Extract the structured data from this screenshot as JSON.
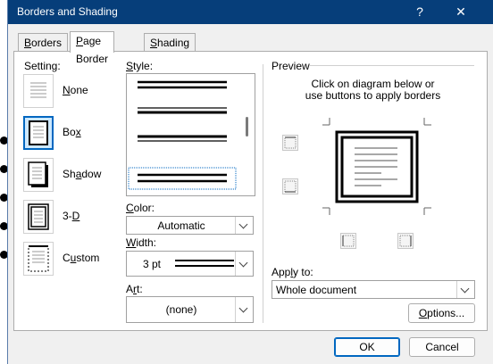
{
  "window": {
    "title": "Borders and Shading",
    "help": "?",
    "close": "✕"
  },
  "tabs": [
    {
      "label_u": "B",
      "label_rest": "orders"
    },
    {
      "label_pre": "",
      "label_u": "P",
      "label_rest": "age Border"
    },
    {
      "label_u": "S",
      "label_rest": "hading"
    }
  ],
  "setting": {
    "heading": "Setting:",
    "items": [
      {
        "label_u": "N",
        "label_rest": "one",
        "selected": false
      },
      {
        "label_u": "x",
        "label_pre": "Bo",
        "label_rest": "",
        "selected": true
      },
      {
        "label_pre": "Sh",
        "label_u": "a",
        "label_rest": "dow",
        "selected": false
      },
      {
        "label_pre": "3-",
        "label_u": "D",
        "label_rest": "",
        "selected": false
      },
      {
        "label_pre": "C",
        "label_u": "u",
        "label_rest": "stom",
        "selected": false
      }
    ]
  },
  "style": {
    "heading_u": "S",
    "heading_pre": "",
    "heading_rest": "tyle:",
    "lines": [
      "double-thick",
      "thin-thick",
      "thick-thin",
      "double-thick-selected"
    ],
    "selected_index": 3
  },
  "color": {
    "label_pre": "",
    "label_u": "C",
    "label_rest": "olor:",
    "value": "Automatic"
  },
  "width": {
    "label_u": "W",
    "label_rest": "idth:",
    "value": "3 pt"
  },
  "art": {
    "label_pre": "A",
    "label_u": "r",
    "label_rest": "t:",
    "value": "(none)"
  },
  "preview": {
    "heading": "Preview",
    "instruction_line1": "Click on diagram below or",
    "instruction_line2": "use buttons to apply borders"
  },
  "apply_to": {
    "label_pre": "App",
    "label_u": "l",
    "label_rest": "y to:",
    "value": "Whole document"
  },
  "buttons": {
    "options_u": "O",
    "options_rest": "ptions...",
    "ok": "OK",
    "cancel": "Cancel"
  },
  "colors": {
    "titlebar": "#063e7a",
    "accent": "#0067c0"
  }
}
